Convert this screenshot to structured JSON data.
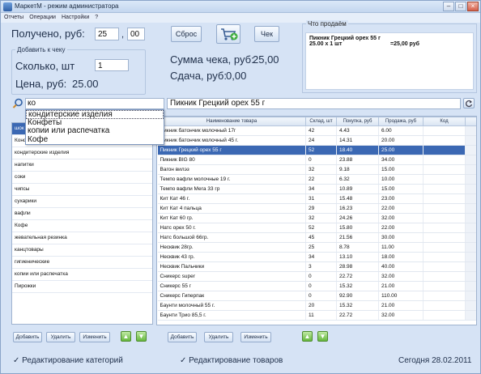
{
  "window": {
    "title": "МаркетМ - режим администратора"
  },
  "menu": [
    "Отчеты",
    "Операции",
    "Настройки",
    "?"
  ],
  "payment": {
    "received_label": "Получено, руб:",
    "rub_value": "25",
    "kop_value": "00",
    "sep": ",",
    "reset_label": "Сброс",
    "check_label": "Чек",
    "sum_label": "Сумма чека, руб:",
    "sum_value": "25,00",
    "change_label": "Сдача, руб:",
    "change_value": "0,00"
  },
  "add_to_check": {
    "group_title": "Добавить к чеку",
    "qty_label": "Сколько, шт",
    "qty_value": "1",
    "price_label": "Цена, руб:",
    "price_value": "25.00"
  },
  "receipt": {
    "title": "Что продаём",
    "line1": "Пикник Грецкий орех 55 г",
    "line2_qty": "25.00 x 1 шт",
    "line2_sum": "=25,00 руб"
  },
  "search": {
    "value": "ко",
    "product_name": "Пикник Грецкий орех 55 г",
    "suggestions": [
      "кондитерские изделия",
      "Конфеты",
      "копии  или  распечатка",
      "Кофе"
    ]
  },
  "categories": [
    {
      "name": "шок",
      "selected": true
    },
    {
      "name": "Конф",
      "selected": false
    },
    {
      "name": "кондитерские изделия",
      "selected": false
    },
    {
      "name": "напитки",
      "selected": false
    },
    {
      "name": "соки",
      "selected": false
    },
    {
      "name": "чипсы",
      "selected": false
    },
    {
      "name": "сухарики",
      "selected": false
    },
    {
      "name": "вафли",
      "selected": false
    },
    {
      "name": "Кофе",
      "selected": false
    },
    {
      "name": "жевательная резинка",
      "selected": false
    },
    {
      "name": "канцтовары",
      "selected": false
    },
    {
      "name": "гигиенические",
      "selected": false
    },
    {
      "name": "копии  или  распечатка",
      "selected": false
    },
    {
      "name": "Пирожки",
      "selected": false
    }
  ],
  "products": {
    "columns": [
      "Наименование товара",
      "Склад, шт",
      "Покупка, руб",
      "Продажа, руб",
      "Код"
    ],
    "rows": [
      {
        "name": "Пикник батончик молочный 17г",
        "stock": "42",
        "buy": "4.43",
        "sell": "6.00",
        "code": "",
        "selected": false
      },
      {
        "name": "Пикник батончик молочный 45 г.",
        "stock": "24",
        "buy": "14.31",
        "sell": "20.00",
        "code": "",
        "selected": false
      },
      {
        "name": "Пикник Грецкий орех 55 г",
        "stock": "52",
        "buy": "18.40",
        "sell": "25.00",
        "code": "",
        "selected": true
      },
      {
        "name": "Пикник BIG 80",
        "stock": "0",
        "buy": "23.88",
        "sell": "34.00",
        "code": "",
        "selected": false
      },
      {
        "name": "Вагон вилэз",
        "stock": "32",
        "buy": "9.18",
        "sell": "15.00",
        "code": "",
        "selected": false
      },
      {
        "name": "Темпо вафли молочные 19 г.",
        "stock": "22",
        "buy": "6.32",
        "sell": "10.00",
        "code": "",
        "selected": false
      },
      {
        "name": "Темпо вафли Мега 33 гр",
        "stock": "34",
        "buy": "10.89",
        "sell": "15.00",
        "code": "",
        "selected": false
      },
      {
        "name": "Кит Кат 46 г.",
        "stock": "31",
        "buy": "15.48",
        "sell": "23.00",
        "code": "",
        "selected": false
      },
      {
        "name": "Кит Кат 4 пальца",
        "stock": "29",
        "buy": "16.23",
        "sell": "22.00",
        "code": "",
        "selected": false
      },
      {
        "name": "Кит Кат 60 гр.",
        "stock": "32",
        "buy": "24.26",
        "sell": "32.00",
        "code": "",
        "selected": false
      },
      {
        "name": "Натс орех 50 г.",
        "stock": "52",
        "buy": "15.80",
        "sell": "22.00",
        "code": "",
        "selected": false
      },
      {
        "name": "Натс большой 66гр.",
        "stock": "45",
        "buy": "21.56",
        "sell": "30.00",
        "code": "",
        "selected": false
      },
      {
        "name": "Несквик 28гр.",
        "stock": "25",
        "buy": "8.78",
        "sell": "11.00",
        "code": "",
        "selected": false
      },
      {
        "name": "Несквик 43 гр.",
        "stock": "34",
        "buy": "13.10",
        "sell": "18.00",
        "code": "",
        "selected": false
      },
      {
        "name": "Несквик Пальчики",
        "stock": "3",
        "buy": "28.98",
        "sell": "40.00",
        "code": "",
        "selected": false
      },
      {
        "name": "Сникерс super",
        "stock": "0",
        "buy": "22.72",
        "sell": "32.00",
        "code": "",
        "selected": false
      },
      {
        "name": "Сникерс 55 г",
        "stock": "0",
        "buy": "15.32",
        "sell": "21.00",
        "code": "",
        "selected": false
      },
      {
        "name": "Сникерс Гиперпак",
        "stock": "0",
        "buy": "92.90",
        "sell": "110.00",
        "code": "",
        "selected": false
      },
      {
        "name": "Баунти молочный 55 г.",
        "stock": "20",
        "buy": "15.32",
        "sell": "21.00",
        "code": "",
        "selected": false
      },
      {
        "name": "Баунти Трио 85,5 г.",
        "stock": "11",
        "buy": "22.72",
        "sell": "32.00",
        "code": "",
        "selected": false
      }
    ]
  },
  "buttons": {
    "add": "Добавить",
    "delete": "Удалить",
    "edit": "Изменить"
  },
  "status": {
    "edit_categories": "Редактирование категорий",
    "edit_products": "Редактирование товаров",
    "today": "Сегодня 28.02.2011"
  }
}
